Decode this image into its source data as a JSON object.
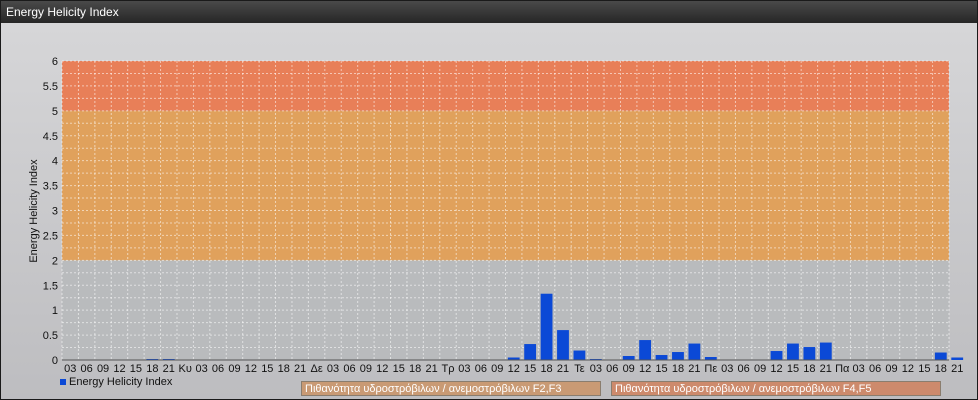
{
  "window": {
    "title": "Energy Helicity Index"
  },
  "chart_data": {
    "type": "bar",
    "title": "",
    "xlabel": "",
    "ylabel": "Energy Helicity Index",
    "ylim": [
      0,
      6
    ],
    "yticks": [
      "0",
      "0.5",
      "1",
      "1.5",
      "2",
      "2.5",
      "3",
      "3.5",
      "4",
      "4.5",
      "5",
      "5.5",
      "6"
    ],
    "grid": true,
    "categories": [
      "03",
      "06",
      "09",
      "12",
      "15",
      "18",
      "21",
      "Κυ",
      "03",
      "06",
      "09",
      "12",
      "15",
      "18",
      "21",
      "Δε",
      "03",
      "06",
      "09",
      "12",
      "15",
      "18",
      "21",
      "Τρ",
      "03",
      "06",
      "09",
      "12",
      "15",
      "18",
      "Τε",
      "03",
      "06",
      "09",
      "12",
      "15",
      "18",
      "21",
      "Πε",
      "03",
      "06",
      "09",
      "12",
      "15",
      "18",
      "21",
      "Πα",
      "03",
      "06",
      "09",
      "12",
      "15",
      "18",
      "21"
    ],
    "xtick_labels": [
      "03",
      "06",
      "09",
      "12",
      "15",
      "18",
      "21",
      "Κυ",
      "03",
      "06",
      "09",
      "12",
      "15",
      "18",
      "21",
      "Δε",
      "03",
      "06",
      "09",
      "12",
      "15",
      "18",
      "21",
      "Τρ",
      "03",
      "06",
      "09",
      "12",
      "15",
      "18",
      "21",
      "Τε",
      "03",
      "06",
      "09",
      "12",
      "15",
      "18",
      "21",
      "Πε",
      "03",
      "06",
      "09",
      "12",
      "15",
      "18",
      "21",
      "Πα",
      "03",
      "06",
      "09",
      "12",
      "15",
      "18",
      "21"
    ],
    "series": [
      {
        "name": "Energy Helicity Index",
        "color": "#0b49d6",
        "values": [
          0.01,
          0.01,
          0.01,
          0.01,
          0.01,
          0.02,
          0.02,
          0.01,
          0.01,
          0.01,
          0.01,
          0.01,
          0.01,
          0.01,
          0.01,
          0.01,
          0.01,
          0.01,
          0.01,
          0.01,
          0.01,
          0.01,
          0.01,
          0.01,
          0.01,
          0.01,
          0.01,
          0.05,
          0.32,
          1.33,
          0.6,
          0.19,
          0.02,
          0.01,
          0.08,
          0.4,
          0.1,
          0.16,
          0.33,
          0.06,
          0.01,
          0.01,
          0.01,
          0.18,
          0.33,
          0.26,
          0.35,
          0.01,
          0.01,
          0.01,
          0.01,
          0.01,
          0.01,
          0.15,
          0.05
        ]
      }
    ],
    "bands": [
      {
        "from": 2,
        "to": 5,
        "color": "#e0a15c"
      },
      {
        "from": 5,
        "to": 6,
        "color": "#e87f58"
      }
    ],
    "legend": {
      "position": "bottom-left"
    }
  },
  "band_legend": {
    "low_label": "Πιθανότητα υδροστρόβιλων / ανεμοστρόβιλων F2,F3",
    "low_color": "#c99a74",
    "high_label": "Πιθανότητα υδροστρόβιλων / ανεμοστρόβιλων F4,F5",
    "high_color": "#cd8a6c"
  }
}
